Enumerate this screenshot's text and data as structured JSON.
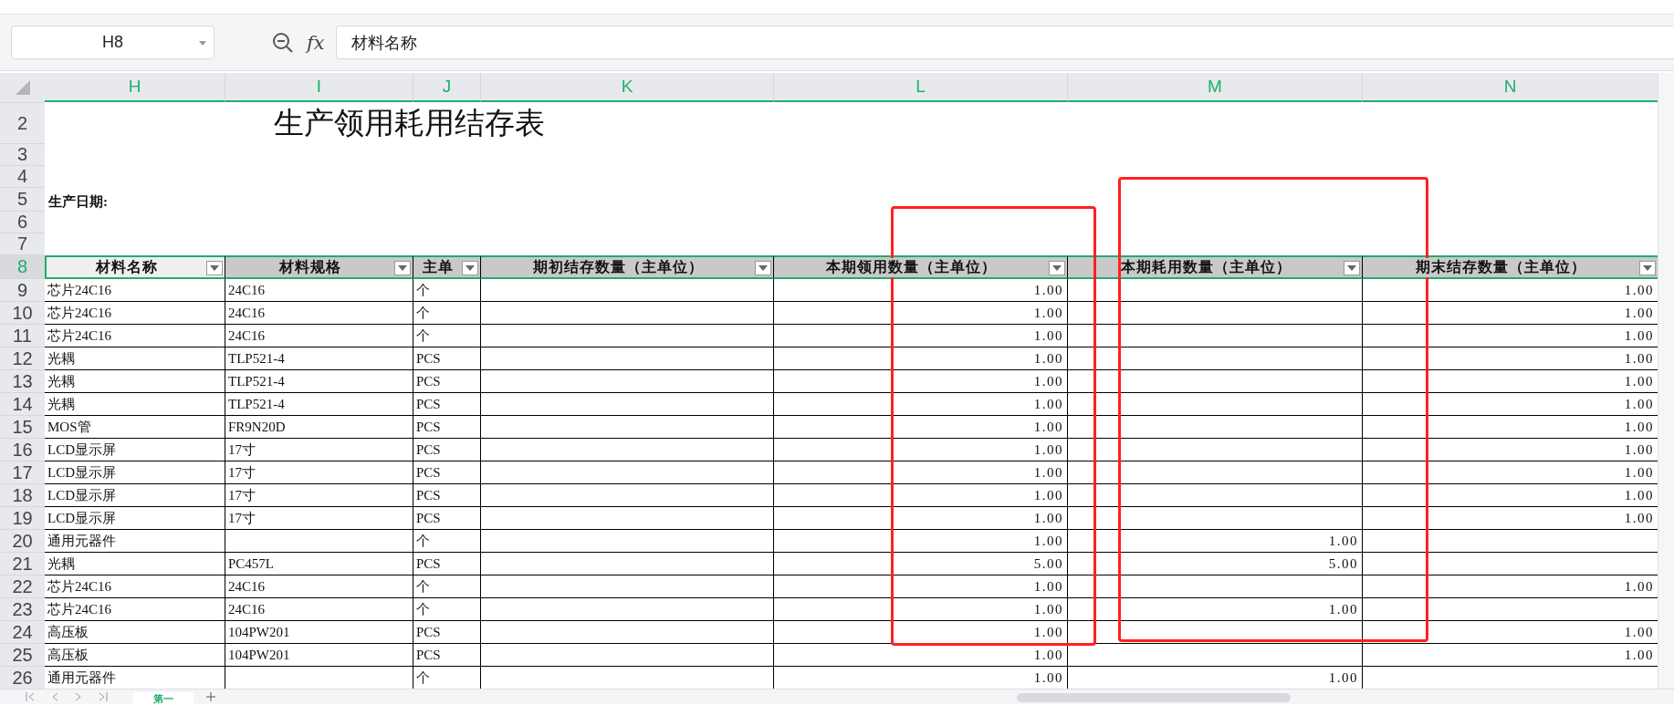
{
  "name_box": {
    "value": "H8"
  },
  "formula_bar": {
    "fx": "fx",
    "value": "材料名称"
  },
  "sheet": {
    "columns": [
      {
        "letter": "H",
        "selected": true
      },
      {
        "letter": "I",
        "selected": true
      },
      {
        "letter": "J",
        "selected": true
      },
      {
        "letter": "K",
        "selected": true
      },
      {
        "letter": "L",
        "selected": true
      },
      {
        "letter": "M",
        "selected": true
      },
      {
        "letter": "N",
        "selected": true
      }
    ],
    "rows": [
      {
        "kind": "title",
        "number": "2",
        "selected": false,
        "text": "生产领用耗用结存表"
      },
      {
        "kind": "blank",
        "number": "3",
        "selected": false
      },
      {
        "kind": "blank",
        "number": "4",
        "selected": false
      },
      {
        "kind": "label",
        "number": "5",
        "selected": false,
        "text": "生产日期:"
      },
      {
        "kind": "blank",
        "number": "6",
        "selected": false
      },
      {
        "kind": "blank",
        "number": "7",
        "selected": false
      },
      {
        "kind": "header",
        "number": "8",
        "selected": true,
        "cells": [
          {
            "text": "材料名称",
            "selected": true
          },
          {
            "text": "材料规格",
            "selected": false
          },
          {
            "text": "主单",
            "selected": false
          },
          {
            "text": "期初结存数量（主单位）",
            "selected": false
          },
          {
            "text": "本期领用数量（主单位）",
            "selected": false
          },
          {
            "text": "本期耗用数量（主单位）",
            "selected": false
          },
          {
            "text": "期末结存数量（主单位）",
            "selected": false
          }
        ]
      },
      {
        "kind": "data",
        "number": "9",
        "selected": false,
        "cells": [
          "芯片24C16",
          "24C16",
          "个",
          null,
          "1.00",
          null,
          "1.00"
        ]
      },
      {
        "kind": "data",
        "number": "10",
        "selected": false,
        "cells": [
          "芯片24C16",
          "24C16",
          "个",
          null,
          "1.00",
          null,
          "1.00"
        ]
      },
      {
        "kind": "data",
        "number": "11",
        "selected": false,
        "cells": [
          "芯片24C16",
          "24C16",
          "个",
          null,
          "1.00",
          null,
          "1.00"
        ]
      },
      {
        "kind": "data",
        "number": "12",
        "selected": false,
        "cells": [
          "光耦",
          "TLP521-4",
          "PCS",
          null,
          "1.00",
          null,
          "1.00"
        ]
      },
      {
        "kind": "data",
        "number": "13",
        "selected": false,
        "cells": [
          "光耦",
          "TLP521-4",
          "PCS",
          null,
          "1.00",
          null,
          "1.00"
        ]
      },
      {
        "kind": "data",
        "number": "14",
        "selected": false,
        "cells": [
          "光耦",
          "TLP521-4",
          "PCS",
          null,
          "1.00",
          null,
          "1.00"
        ]
      },
      {
        "kind": "data",
        "number": "15",
        "selected": false,
        "cells": [
          "MOS管",
          "FR9N20D",
          "PCS",
          null,
          "1.00",
          null,
          "1.00"
        ]
      },
      {
        "kind": "data",
        "number": "16",
        "selected": false,
        "cells": [
          "LCD显示屏",
          "17寸",
          "PCS",
          null,
          "1.00",
          null,
          "1.00"
        ]
      },
      {
        "kind": "data",
        "number": "17",
        "selected": false,
        "cells": [
          "LCD显示屏",
          "17寸",
          "PCS",
          null,
          "1.00",
          null,
          "1.00"
        ]
      },
      {
        "kind": "data",
        "number": "18",
        "selected": false,
        "cells": [
          "LCD显示屏",
          "17寸",
          "PCS",
          null,
          "1.00",
          null,
          "1.00"
        ]
      },
      {
        "kind": "data",
        "number": "19",
        "selected": false,
        "cells": [
          "LCD显示屏",
          "17寸",
          "PCS",
          null,
          "1.00",
          null,
          "1.00"
        ]
      },
      {
        "kind": "data",
        "number": "20",
        "selected": false,
        "cells": [
          "通用元器件",
          null,
          "个",
          null,
          "1.00",
          "1.00",
          null
        ]
      },
      {
        "kind": "data",
        "number": "21",
        "selected": false,
        "cells": [
          "光耦",
          "PC457L",
          "PCS",
          null,
          "5.00",
          "5.00",
          null
        ]
      },
      {
        "kind": "data",
        "number": "22",
        "selected": false,
        "cells": [
          "芯片24C16",
          "24C16",
          "个",
          null,
          "1.00",
          null,
          "1.00"
        ]
      },
      {
        "kind": "data",
        "number": "23",
        "selected": false,
        "cells": [
          "芯片24C16",
          "24C16",
          "个",
          null,
          "1.00",
          "1.00",
          null
        ]
      },
      {
        "kind": "data",
        "number": "24",
        "selected": false,
        "cells": [
          "高压板",
          "104PW201",
          "PCS",
          null,
          "1.00",
          null,
          "1.00"
        ]
      },
      {
        "kind": "data",
        "number": "25",
        "selected": false,
        "cells": [
          "高压板",
          "104PW201",
          "PCS",
          null,
          "1.00",
          null,
          "1.00"
        ]
      },
      {
        "kind": "data",
        "number": "26",
        "selected": false,
        "cells": [
          "通用元器件",
          null,
          "个",
          null,
          "1.00",
          "1.00",
          null
        ]
      }
    ],
    "annotations": [
      {
        "kind": "rect",
        "color": "#ff2020"
      },
      {
        "kind": "rect",
        "color": "#ff2020"
      }
    ]
  },
  "sheet_tabs": [
    {
      "label": "第一",
      "selected": true
    }
  ]
}
